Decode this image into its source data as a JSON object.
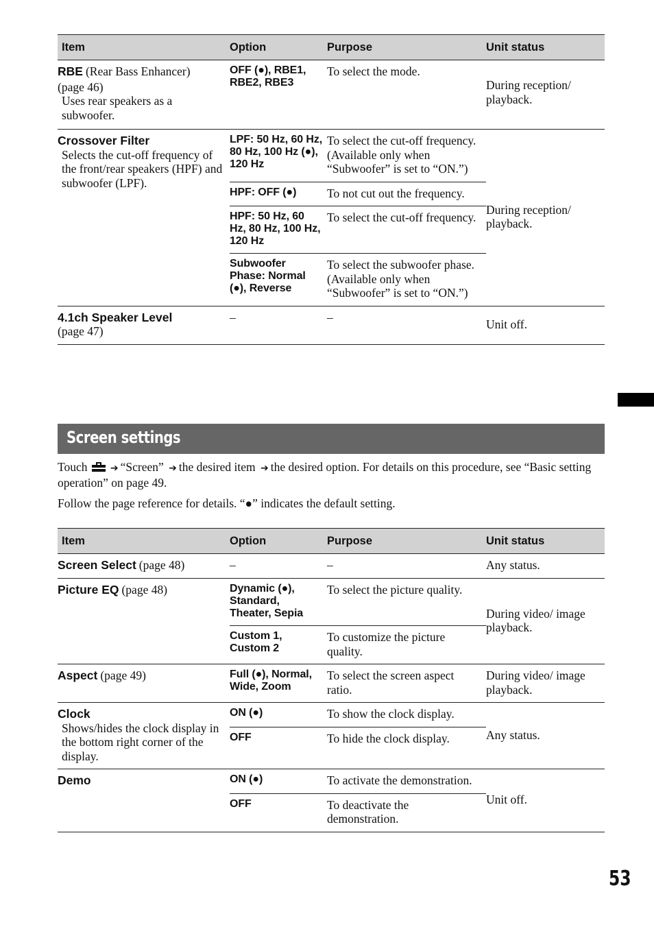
{
  "columns": [
    "Item",
    "Option",
    "Purpose",
    "Unit status"
  ],
  "default_marker": "●",
  "sound_table": {
    "rows": [
      {
        "item_name": "RBE",
        "item_ref": "(Rear Bass Enhancer)",
        "item_ref2": "(page 46)",
        "item_desc": "Uses rear speakers as a subwoofer.",
        "options": [
          {
            "option": "OFF (●), RBE1, RBE2, RBE3",
            "purpose": "To select the mode."
          }
        ],
        "status": "During reception/ playback."
      },
      {
        "item_name": "Crossover Filter",
        "item_desc": "Selects the cut-off frequency of the front/rear speakers (HPF) and subwoofer (LPF).",
        "options": [
          {
            "option": "LPF: 50 Hz, 60 Hz, 80 Hz, 100 Hz (●), 120 Hz",
            "purpose": "To select the cut-off frequency. (Available only when “Subwoofer” is set to “ON.”)"
          },
          {
            "option": "HPF: OFF (●)",
            "purpose": "To not cut out the frequency."
          },
          {
            "option": "HPF: 50 Hz, 60 Hz, 80 Hz, 100 Hz, 120 Hz",
            "purpose": "To select the cut-off frequency."
          },
          {
            "option": "Subwoofer Phase: Normal (●), Reverse",
            "purpose": "To select the subwoofer phase. (Available only when “Subwoofer” is set to “ON.”)"
          }
        ],
        "status": "During reception/ playback."
      },
      {
        "item_name": "4.1ch Speaker Level",
        "item_ref2": "(page 47)",
        "options": [
          {
            "option": "–",
            "purpose": "–"
          }
        ],
        "status": "Unit off."
      }
    ]
  },
  "section": {
    "title": "Screen settings",
    "intro_touch": "Touch",
    "intro_icon": "toolbox-settings-icon",
    "intro_step1": "“Screen”",
    "intro_step2": "the desired item",
    "intro_step3": "the desired option. For details on this procedure, see “Basic setting operation” on page 49.",
    "note": "Follow the page reference for details. “●” indicates the default setting."
  },
  "screen_table": {
    "rows": [
      {
        "item_name": "Screen Select",
        "item_ref": "(page 48)",
        "options": [
          {
            "option": "–",
            "purpose": "–"
          }
        ],
        "status": "Any status."
      },
      {
        "item_name": "Picture EQ",
        "item_ref": "(page 48)",
        "options": [
          {
            "option": "Dynamic (●), Standard, Theater, Sepia",
            "purpose": "To select the picture quality."
          },
          {
            "option": "Custom 1, Custom 2",
            "purpose": "To customize the picture quality."
          }
        ],
        "status": "During video/ image playback."
      },
      {
        "item_name": "Aspect",
        "item_ref": "(page 49)",
        "options": [
          {
            "option": "Full (●), Normal, Wide, Zoom",
            "purpose": "To select the screen aspect ratio."
          }
        ],
        "status": "During video/ image playback."
      },
      {
        "item_name": "Clock",
        "item_desc": "Shows/hides the clock display in the bottom right corner of the display.",
        "options": [
          {
            "option": "ON (●)",
            "purpose": "To show the clock display."
          },
          {
            "option": "OFF",
            "purpose": "To hide the clock display."
          }
        ],
        "status": "Any status."
      },
      {
        "item_name": "Demo",
        "options": [
          {
            "option": "ON (●)",
            "purpose": "To activate the demonstration."
          },
          {
            "option": "OFF",
            "purpose": "To deactivate the demonstration."
          }
        ],
        "status": "Unit off."
      }
    ]
  },
  "page_number": "53",
  "colors": {
    "header_fill": "#d2d2d2",
    "section_band": "#666666",
    "side_tab": "#000000"
  }
}
